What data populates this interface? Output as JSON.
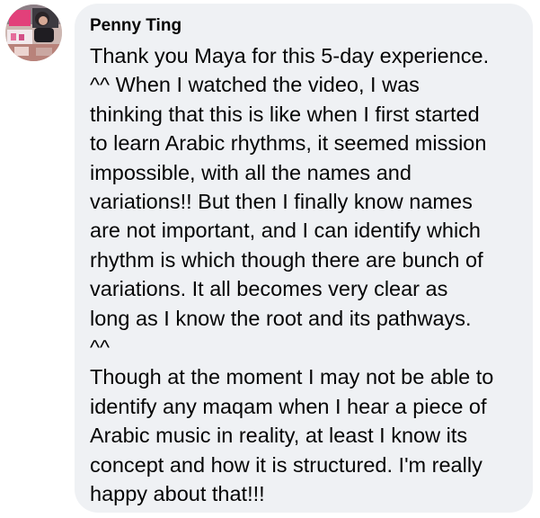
{
  "comment": {
    "author": "Penny Ting",
    "paragraphs": [
      {
        "lines": [
          "Thank you Maya for this 5-day experience.",
          "^^  When I watched the video, I was",
          "thinking that this is like when I first started",
          "to learn Arabic rhythms, it seemed mission",
          "impossible, with all the names and",
          "variations!!  But then I finally know names",
          "are not important, and I can identify which",
          "rhythm is which though there are bunch of",
          "variations.  It all becomes very clear as",
          "long as I know the root and its pathways.",
          "^^"
        ]
      },
      {
        "lines": [
          "Though at the moment I may not be able to",
          "identify any maqam when I hear a piece of",
          "Arabic music in reality, at least I know its",
          "concept and how it is structured.  I'm really",
          "happy about that!!!"
        ]
      }
    ]
  },
  "colors": {
    "bubble_background": "#eff1f4",
    "text": "#050505"
  }
}
